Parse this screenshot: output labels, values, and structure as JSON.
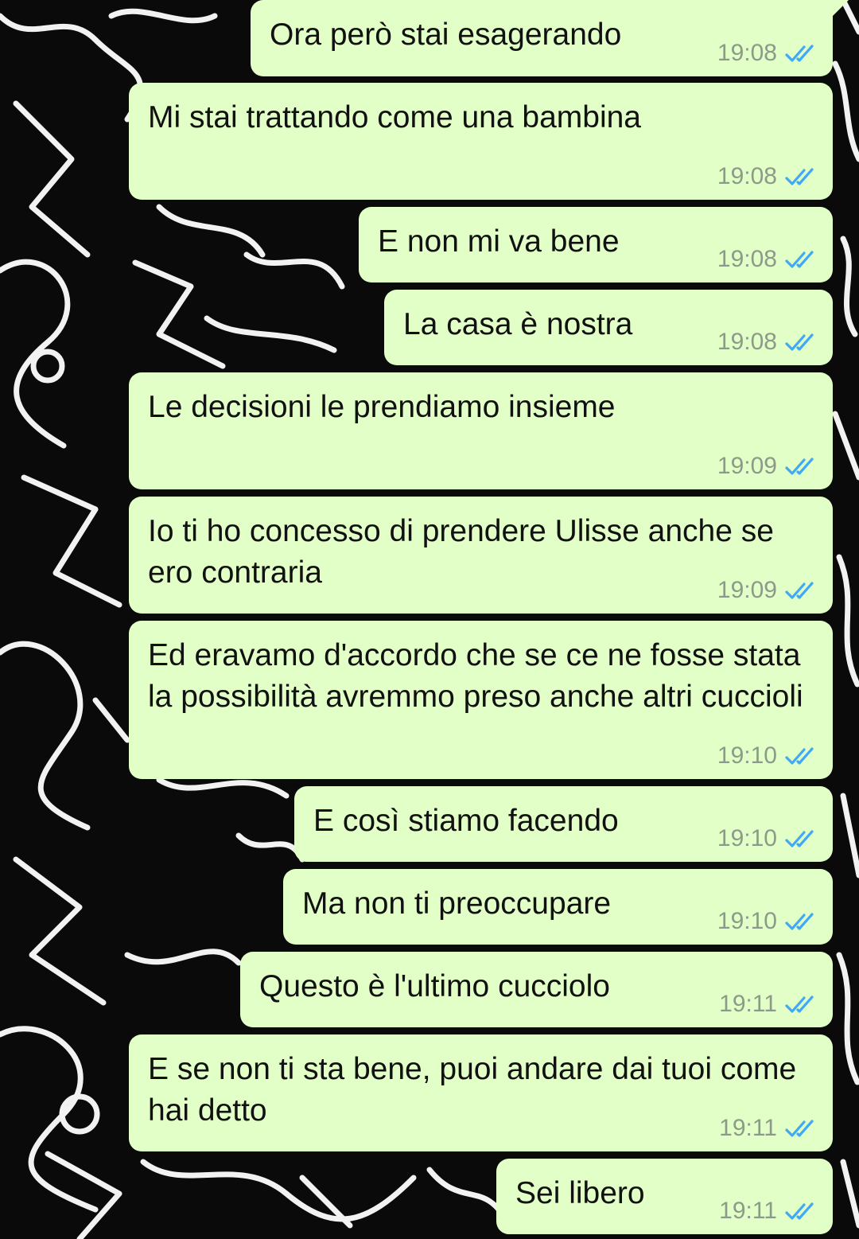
{
  "wallpaper": {
    "description_icon": "doodle-pattern-background"
  },
  "colors": {
    "bubble": "#e2ffc7",
    "time_text": "#8c9a8a",
    "read_ticks": "#3fa9f5"
  },
  "messages": [
    {
      "text": "Ora però stai esagerando",
      "time": "19:08",
      "status_icon": "double-check-read-icon"
    },
    {
      "text": "Mi stai trattando come una bambina",
      "time": "19:08",
      "status_icon": "double-check-read-icon"
    },
    {
      "text": "E non mi va bene",
      "time": "19:08",
      "status_icon": "double-check-read-icon"
    },
    {
      "text": "La casa è nostra",
      "time": "19:08",
      "status_icon": "double-check-read-icon"
    },
    {
      "text": "Le decisioni le prendiamo insieme",
      "time": "19:09",
      "status_icon": "double-check-read-icon"
    },
    {
      "text": "Io ti ho concesso di prendere Ulisse anche se ero contraria",
      "time": "19:09",
      "status_icon": "double-check-read-icon"
    },
    {
      "text": "Ed eravamo d'accordo che se ce ne fosse stata la possibilità avremmo preso anche altri cuccioli",
      "time": "19:10",
      "status_icon": "double-check-read-icon"
    },
    {
      "text": "E così stiamo facendo",
      "time": "19:10",
      "status_icon": "double-check-read-icon"
    },
    {
      "text": "Ma non ti preoccupare",
      "time": "19:10",
      "status_icon": "double-check-read-icon"
    },
    {
      "text": "Questo è l'ultimo cucciolo",
      "time": "19:11",
      "status_icon": "double-check-read-icon"
    },
    {
      "text": "E se non ti sta bene, puoi andare dai tuoi come hai detto",
      "time": "19:11",
      "status_icon": "double-check-read-icon"
    },
    {
      "text": "Sei libero",
      "time": "19:11",
      "status_icon": "double-check-read-icon"
    }
  ]
}
